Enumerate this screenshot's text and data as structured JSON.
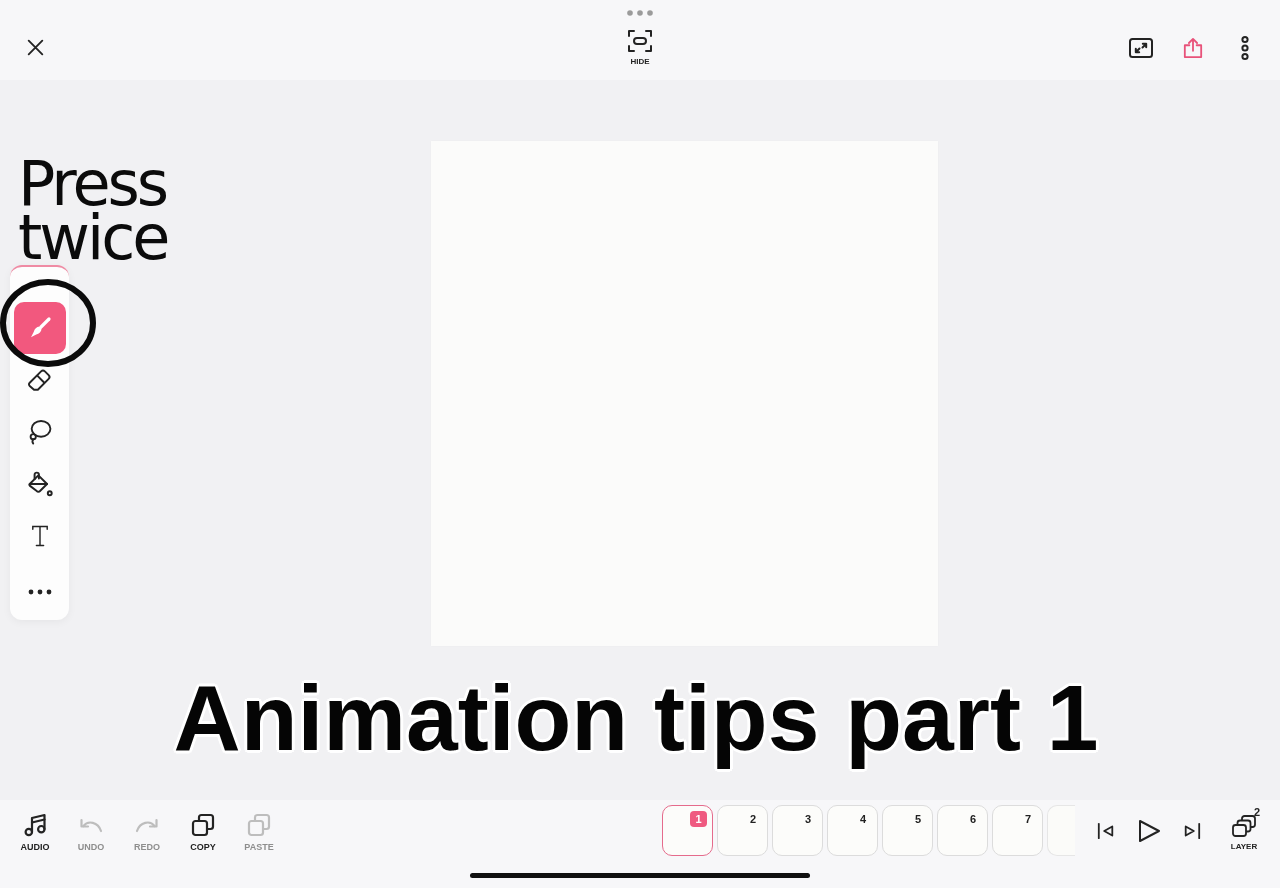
{
  "top_bar": {
    "hide_button": {
      "label": "HIDE"
    }
  },
  "annotation": {
    "text": "Press twice"
  },
  "tools": [
    {
      "kind": "brush",
      "selected": true
    },
    {
      "kind": "eraser",
      "selected": false
    },
    {
      "kind": "lasso",
      "selected": false
    },
    {
      "kind": "fill",
      "selected": false
    },
    {
      "kind": "text",
      "selected": false
    }
  ],
  "caption": "Animation tips part 1",
  "bottom_bar": {
    "actions": [
      {
        "kind": "audio",
        "label": "AUDIO",
        "disabled": false
      },
      {
        "kind": "undo",
        "label": "UNDO",
        "disabled": true
      },
      {
        "kind": "redo",
        "label": "REDO",
        "disabled": true
      },
      {
        "kind": "copy",
        "label": "COPY",
        "disabled": false
      },
      {
        "kind": "paste",
        "label": "PASTE",
        "disabled": true
      }
    ],
    "frames": [
      {
        "number": "1",
        "selected": true
      },
      {
        "number": "2",
        "selected": false
      },
      {
        "number": "3",
        "selected": false
      },
      {
        "number": "4",
        "selected": false
      },
      {
        "number": "5",
        "selected": false
      },
      {
        "number": "6",
        "selected": false
      },
      {
        "number": "7",
        "selected": false
      },
      {
        "selected": false
      }
    ],
    "layer_button": {
      "label": "LAYER",
      "count": "2"
    }
  }
}
